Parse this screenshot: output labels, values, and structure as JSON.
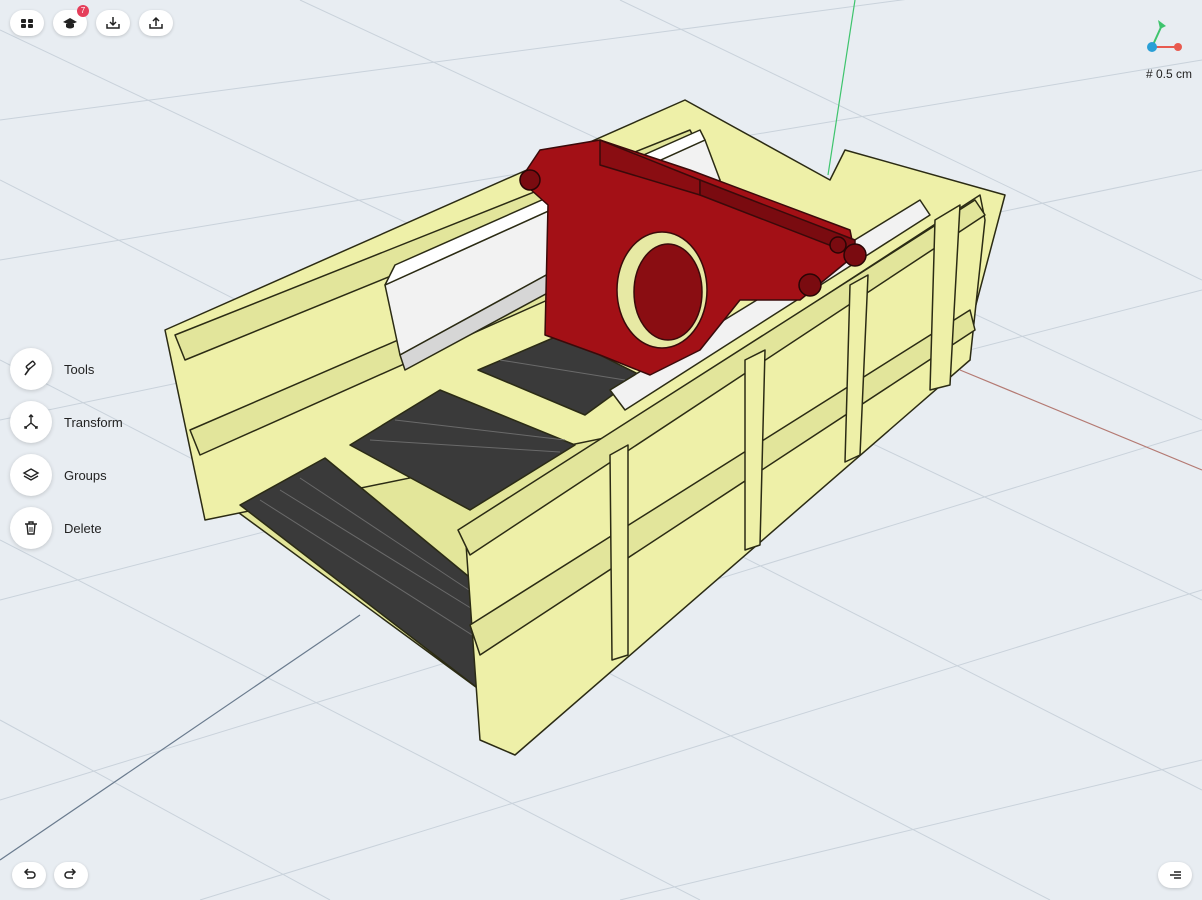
{
  "toolbar": {
    "badge_count": "7"
  },
  "side_tools": [
    {
      "label": "Tools",
      "icon": "hammer-icon"
    },
    {
      "label": "Transform",
      "icon": "transform-icon"
    },
    {
      "label": "Groups",
      "icon": "layers-icon"
    },
    {
      "label": "Delete",
      "icon": "trash-icon"
    }
  ],
  "grid": {
    "size_label": "# 0.5 cm"
  },
  "colors": {
    "background": "#e8edf2",
    "model_frame": "#eef0a8",
    "model_part": "#a31016",
    "rails": "#f2f2f2",
    "grates": "#3a3a3a",
    "axis_x": "#e85a4f",
    "axis_y": "#3ec46d",
    "axis_z": "#2a9fd6"
  }
}
